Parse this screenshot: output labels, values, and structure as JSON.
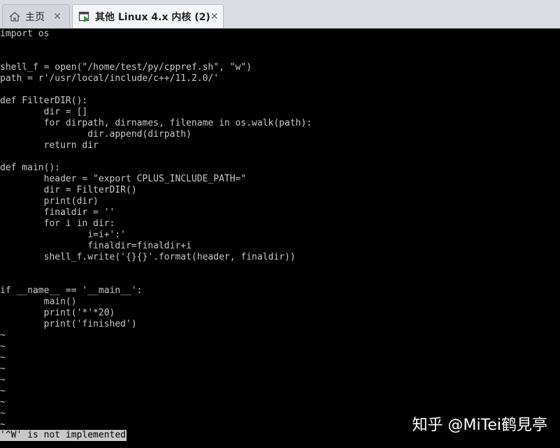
{
  "tabs": [
    {
      "label": "主页",
      "icon": "home-icon"
    },
    {
      "label": "其他 Linux 4.x 内核 (2)",
      "icon": "vm-icon"
    }
  ],
  "code_lines": [
    "import os",
    "",
    "",
    "shell_f = open(\"/home/test/py/cppref.sh\", \"w\")",
    "path = r'/usr/local/include/c++/11.2.0/'",
    "",
    "def FilterDIR():",
    "        dir = []",
    "        for dirpath, dirnames, filename in os.walk(path):",
    "                dir.append(dirpath)",
    "        return dir",
    "",
    "def main():",
    "        header = \"export CPLUS_INCLUDE_PATH=\"",
    "        dir = FilterDIR()",
    "        print(dir)",
    "        finaldir = ''",
    "        for i in dir:",
    "                i=i+':'",
    "                finaldir=finaldir+i",
    "        shell_f.write('{}{}'.format(header, finaldir))",
    "",
    "",
    "if __name__ == '__main__':",
    "        main()",
    "        print('*'*20)",
    "        print('finished')",
    "~",
    "~",
    "~",
    "~",
    "~",
    "~",
    "~",
    "~",
    "~"
  ],
  "status_line": "'^W' is not implemented",
  "watermark": "知乎 @MiTei鹤見亭"
}
